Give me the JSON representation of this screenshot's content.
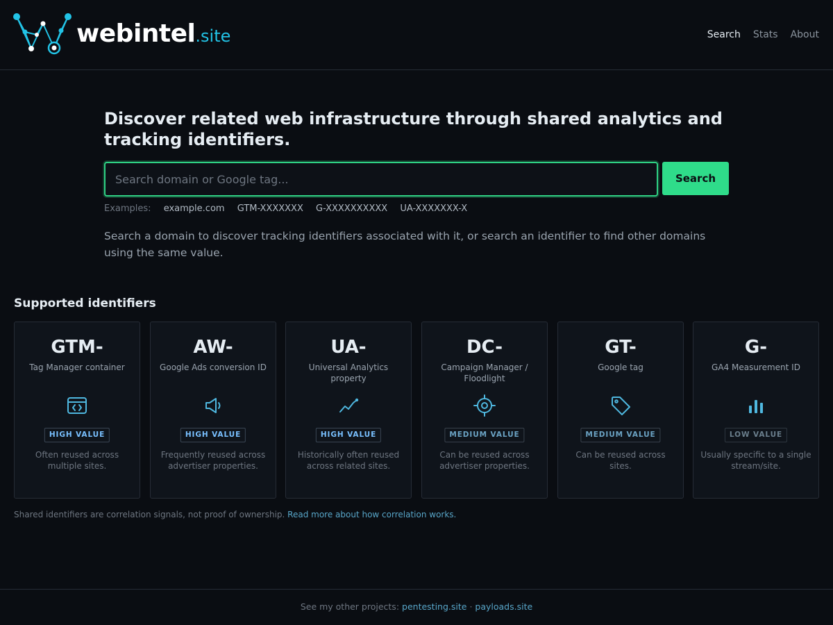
{
  "header": {
    "brand_name": "webintel",
    "brand_tld": ".site",
    "nav": [
      {
        "label": "Search",
        "active": true
      },
      {
        "label": "Stats",
        "active": false
      },
      {
        "label": "About",
        "active": false
      }
    ]
  },
  "hero": {
    "heading": "Discover related web infrastructure through shared analytics and tracking identifiers.",
    "search_placeholder": "Search domain or Google tag...",
    "search_value": "",
    "search_button": "Search",
    "examples_label": "Examples:",
    "examples": [
      "example.com",
      "GTM-XXXXXXX",
      "G-XXXXXXXXXX",
      "UA-XXXXXXX-X"
    ],
    "description": "Search a domain to discover tracking identifiers associated with it, or search an identifier to find other domains using the same value."
  },
  "identifiers": {
    "title": "Supported identifiers",
    "cards": [
      {
        "prefix": "GTM-",
        "desc": "Tag Manager container",
        "icon": "code-window-icon",
        "badge": "HIGH VALUE",
        "level": "high",
        "note": "Often reused across multiple sites."
      },
      {
        "prefix": "AW-",
        "desc": "Google Ads conversion ID",
        "icon": "megaphone-icon",
        "badge": "HIGH VALUE",
        "level": "high",
        "note": "Frequently reused across advertiser properties."
      },
      {
        "prefix": "UA-",
        "desc": "Universal Analytics property",
        "icon": "trend-line-icon",
        "badge": "HIGH VALUE",
        "level": "high",
        "note": "Historically often reused across related sites."
      },
      {
        "prefix": "DC-",
        "desc": "Campaign Manager / Floodlight",
        "icon": "crosshair-icon",
        "badge": "MEDIUM VALUE",
        "level": "medium",
        "note": "Can be reused across advertiser properties."
      },
      {
        "prefix": "GT-",
        "desc": "Google tag",
        "icon": "tag-icon",
        "badge": "MEDIUM VALUE",
        "level": "medium",
        "note": "Can be reused across sites."
      },
      {
        "prefix": "G-",
        "desc": "GA4 Measurement ID",
        "icon": "bar-chart-icon",
        "badge": "LOW VALUE",
        "level": "low",
        "note": "Usually specific to a single stream/site."
      }
    ],
    "disclaimer_text": "Shared identifiers are correlation signals, not proof of ownership.",
    "disclaimer_link": "Read more about how correlation works."
  },
  "footer": {
    "prefix": "See my other projects:",
    "link1": "pentesting.site",
    "separator": "·",
    "link2": "payloads.site"
  },
  "colors": {
    "background": "#0a0d12",
    "accent_green": "#2fdc8a",
    "accent_cyan": "#22c3e6",
    "icon_blue": "#4fb8e0"
  }
}
